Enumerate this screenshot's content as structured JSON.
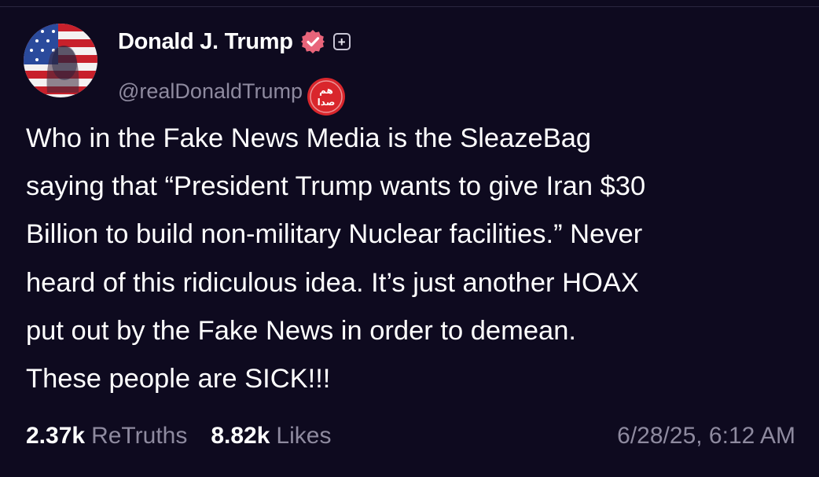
{
  "post": {
    "author": {
      "display_name": "Donald J. Trump",
      "handle": "@realDonaldTrump",
      "verified": true,
      "avatar_icon": "flag-portrait-avatar"
    },
    "watermark_text": "صدا هم",
    "text": "Who in the Fake News Media is the SleazeBag\nsaying that “President Trump wants to give Iran $30\nBillion to build non-military Nuclear facilities.” Never\nheard of this ridiculous idea. It’s just another HOAX\nput out by the Fake News in order to demean.\nThese people are SICK!!!",
    "stats": {
      "retruths_count": "2.37k",
      "retruths_label": "ReTruths",
      "likes_count": "8.82k",
      "likes_label": "Likes"
    },
    "timestamp": "6/28/25, 6:12 AM"
  },
  "colors": {
    "background": "#0e0a1f",
    "verified_badge": "#e8647a",
    "muted_text": "#8e8a9f",
    "watermark_red": "#d9262c"
  }
}
